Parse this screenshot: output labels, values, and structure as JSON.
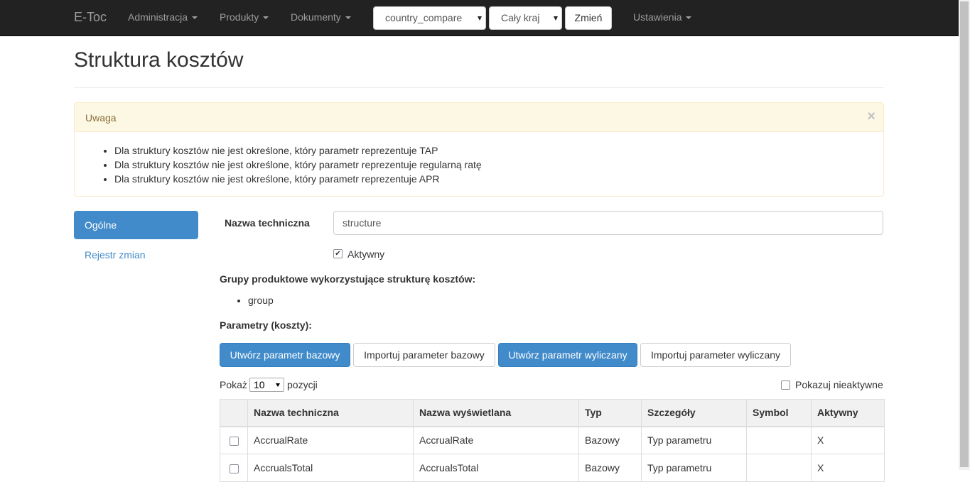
{
  "navbar": {
    "brand": "E-Toc",
    "menu_administracja": "Administracja",
    "menu_produkty": "Produkty",
    "menu_dokumenty": "Dokumenty",
    "select_dataset": "country_compare",
    "select_region": "Cały kraj",
    "change_button": "Zmień",
    "menu_ustawienia": "Ustawienia"
  },
  "page": {
    "title": "Struktura kosztów"
  },
  "alert": {
    "title": "Uwaga",
    "close": "×",
    "items": [
      "Dla struktury kosztów nie jest określone, który parametr reprezentuje TAP",
      "Dla struktury kosztów nie jest określone, który parametr reprezentuje regularną ratę",
      "Dla struktury kosztów nie jest określone, który parametr reprezentuje APR"
    ]
  },
  "sidenav": {
    "active": "Ogólne",
    "link": "Rejestr zmian"
  },
  "form": {
    "name_label": "Nazwa techniczna",
    "name_value": "structure",
    "active_checked": true,
    "active_label": "Aktywny",
    "groups_heading": "Grupy produktowe wykorzystujące strukturę kosztów:",
    "groups": [
      "group"
    ],
    "params_heading": "Parametry (koszty):"
  },
  "buttons": {
    "create_base": "Utwórz parametr bazowy",
    "import_base": "Importuj parameter bazowy",
    "create_calc": "Utwórz parametr wyliczany",
    "import_calc": "Importuj parameter wyliczany"
  },
  "table_controls": {
    "show_label": "Pokaż",
    "page_size": "10",
    "items_label": "pozycji",
    "show_inactive_label": "Pokazuj nieaktywne"
  },
  "table": {
    "headers": [
      "",
      "Nazwa techniczna",
      "Nazwa wyświetlana",
      "Typ",
      "Szczegóły",
      "Symbol",
      "Aktywny"
    ],
    "rows": [
      {
        "technical": "AccrualRate",
        "display": "AccrualRate",
        "type": "Bazowy",
        "details": "Typ parametru",
        "symbol": "",
        "active": "X"
      },
      {
        "technical": "AccrualsTotal",
        "display": "AccrualsTotal",
        "type": "Bazowy",
        "details": "Typ parametru",
        "symbol": "",
        "active": "X"
      }
    ]
  },
  "colors": {
    "navbar_bg": "#222222",
    "primary": "#428bca",
    "alert_bg": "#fcf8e3",
    "alert_text": "#8a6d3b"
  }
}
